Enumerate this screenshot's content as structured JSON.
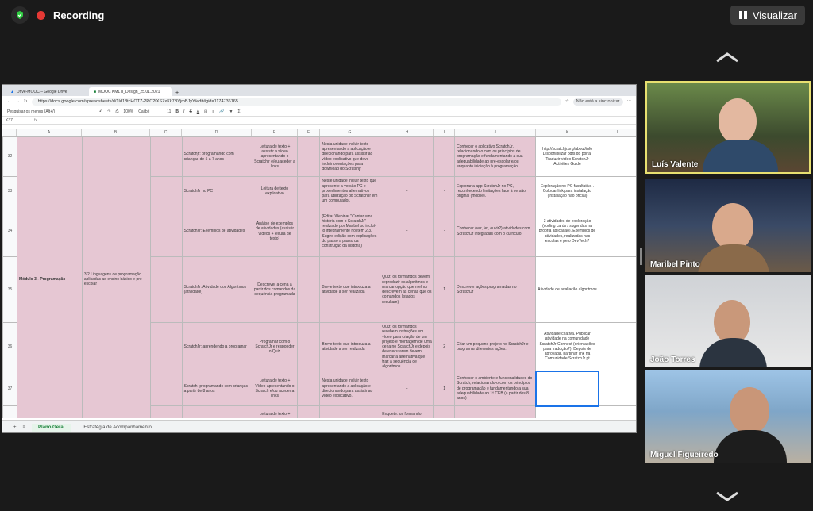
{
  "zoom": {
    "recording_label": "Recording",
    "view_button": "Visualizar"
  },
  "browser": {
    "tabs": [
      "Drive-MOOC – Google Drive",
      "MOOC KML II_Design_25.01.2021"
    ],
    "url": "https://docs.google.com/spreadsheets/d/1Id18tcHOTZ-2RC2fXSZxKk7BVjmBJyY/edit#gid=1174736165",
    "sync_label": "Não está a sincronizar"
  },
  "sheet": {
    "search_menu": "Pesquisar os menus (Alt+/)",
    "zoom": "100%",
    "font": "Calibri",
    "font_size": "11",
    "cell_ref": "K37",
    "columns": [
      "A",
      "B",
      "C",
      "D",
      "E",
      "F",
      "G",
      "H",
      "I",
      "J",
      "K",
      "L"
    ],
    "module_label": "Módulo 3 - Programação",
    "col_b_text": "3.2 Linguagens de programação aplicadas ao ensino básico e pré-escolar",
    "rows": [
      {
        "n": "32",
        "d": "Scratchjr: programando com crianças de 5 a 7 anos",
        "e": "Leitura de texto + assistir a vídeo apresentando o Scratchjr e/ou aceder a links",
        "g": "Nesta unidade incluir texto apresentando a aplicação e direcionando para assistir ao vídeo explicativo que deve incluir orientações para download do Scratchjr",
        "h": "-",
        "i": "-",
        "j": "Conhecer o aplicativo ScratchJr, relacionando-o com os princípios de programação e fundamentando a sua adequabilidade ao pré-escolar e/ou enquanto iniciação à programação.",
        "k": "http://scratchjr.org/about/info  Disponibilizar pdfs do portal  Traduzir vídeo ScratchJr Activities Guide"
      },
      {
        "n": "33",
        "d": "ScratchJr no PC",
        "e": "Leitura de texto explicativo",
        "g": "Neste unidade incluir texto que apresente a versão PC e procedimentos alternativos para utilização do ScratchJr em um computador.",
        "h": "-",
        "i": "-",
        "j": "Explorar a app ScratchJr no PC, reconhecendo limitações face à versão original (mobile).",
        "k": "Exploração no PC facultativa . Colocar link para instalação (instalação não oficial)"
      },
      {
        "n": "34",
        "d": "ScratchJr: Exemplos de atividades",
        "e": "Análise de exemplos de atividades (assistir vídeos + leitura de texto)",
        "g": "(Editar Webinar \"Contar uma história com o ScratchJr\" realizado por Maribel ou incluí-lo integralmente no item 2.3. Sugiro edição com explicações do passo a passo da construção da história)",
        "h": "-",
        "i": "-",
        "j": "Conhecer (ver, ler, ouvir?) atividades com ScratchJr integradas com o currículo",
        "k": "3 atividades de exploração (coding cards / sugeridas na própria aplicação). Exemplos de atividades, realizadas nas escolas e pelo DevTech?"
      },
      {
        "n": "35",
        "d": "ScratchJr: Atividade dos Algoritmos (atividade)",
        "e": "Descrever a cena a partir dos comandos da sequência programada",
        "g": "Breve texto que introduza a atividade a ser realizada",
        "h": "Quiz: os formandos devem reproduzir os algoritmos e marcar opção que melhor descrevem as cenas que os comandos listados resultam)",
        "i": "1",
        "j": "Descrever ações programadas no ScratchJr",
        "k": "Atividade de avaliação algoritmos"
      },
      {
        "n": "36",
        "d": "ScratchJr: aprendendo a programar",
        "e": "Programar com o ScratchJr e responder o Quiz",
        "g": "Breve texto que introduza a atividade a ser realizada",
        "h": "Quiz: os formandos recebem instruções em vídeo para criação de um projeto e montagem de uma cena no ScratchJr e depois de executarem devem marcar a alternativa que traz a sequência de algoritmos",
        "i": "2",
        "j": "Criar um pequeno projeto no ScratchJr e programar diferentes ações.",
        "k": "Atividade criativa. Publicar atividade na comunidade ScratchJr Connect (orientações para tradução?). Depois de aprovada, partilhar link na Comunidade ScratchJr pt"
      },
      {
        "n": "37",
        "d": "Scratch: programando com crianças a partir de 8 anos",
        "e": "Leitura de texto + Vídeo apresentando o Scratch e/ou aceder a links",
        "g": "Nesta unidade incluir texto apresentando a aplicação e direcionando para assistir ao vídeo explicativo.",
        "h": "-",
        "i": "1",
        "j": "Conhecer o ambiente e funcionalidades do Scratch, relacionando-o com os princípios de programação e fundamentando a sua adequabilidade ao 1º CEB (a partir dos 8 anos)",
        "k": ""
      }
    ],
    "last_row_e": "Leitura de texto +",
    "last_row_h": "Enquete: os formando",
    "sheet_tabs": [
      "Plano Geral",
      "Estratégia de Acompanhamento"
    ]
  },
  "participants": [
    "Luís Valente",
    "Maribel Pinto",
    "João Torres",
    "Miguel Figueiredo"
  ]
}
